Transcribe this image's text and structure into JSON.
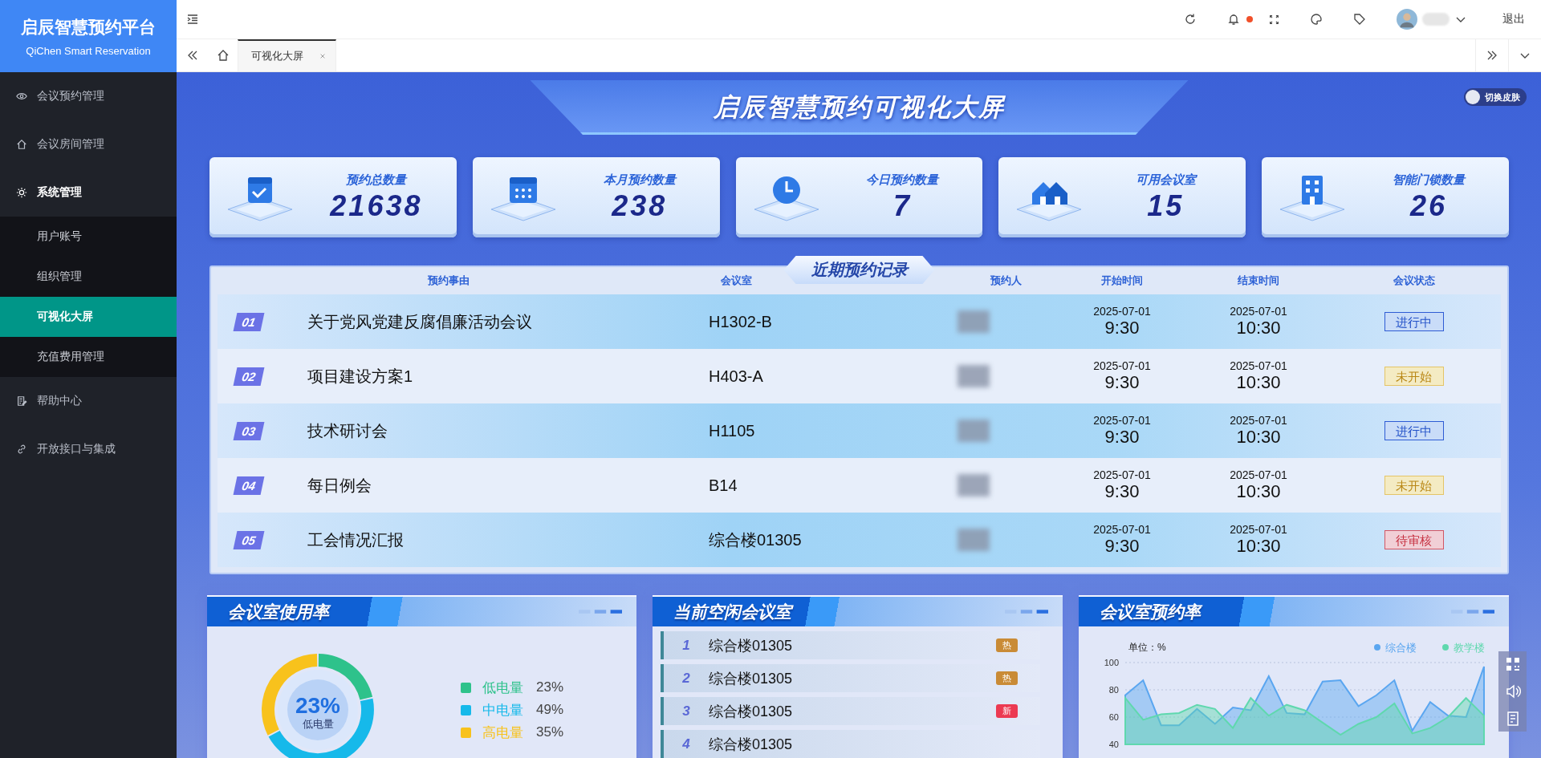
{
  "sidebar": {
    "brand_title": "启辰智慧预约平台",
    "brand_subtitle": "QiChen Smart Reservation",
    "items": [
      {
        "label": "会议预约管理",
        "selected": false,
        "expanded": false
      },
      {
        "label": "会议房间管理",
        "selected": false,
        "expanded": false
      },
      {
        "label": "系统管理",
        "selected": false,
        "expanded": true,
        "children": [
          {
            "label": "用户账号",
            "selected": false
          },
          {
            "label": "组织管理",
            "selected": false
          },
          {
            "label": "可视化大屏",
            "selected": true
          },
          {
            "label": "充值费用管理",
            "selected": false
          }
        ]
      },
      {
        "label": "帮助中心",
        "selected": false,
        "expanded": false
      },
      {
        "label": "开放接口与集成",
        "selected": false,
        "expanded": false
      }
    ]
  },
  "topbar": {
    "logout": "退出",
    "notification_unread": true
  },
  "tabs": [
    {
      "label": "可视化大屏",
      "selected": true
    }
  ],
  "dashboard": {
    "title": "启辰智慧预约可视化大屏",
    "skin_label": "切换皮肤",
    "stats": [
      {
        "label": "预约总数量",
        "value": "21638"
      },
      {
        "label": "本月预约数量",
        "value": "238"
      },
      {
        "label": "今日预约数量",
        "value": "7"
      },
      {
        "label": "可用会议室",
        "value": "15"
      },
      {
        "label": "智能门锁数量",
        "value": "26"
      }
    ],
    "recent": {
      "title": "近期预约记录",
      "columns": [
        "预约事由",
        "会议室",
        "预约人",
        "开始时间",
        "结束时间",
        "会议状态"
      ],
      "rows": [
        {
          "index": "01",
          "subject": "关于党风党建反腐倡廉活动会议",
          "room": "H1302-B",
          "start_date": "2025-07-01",
          "start_time": "9:30",
          "end_date": "2025-07-01",
          "end_time": "10:30",
          "status": {
            "label": "进行中",
            "kind": "active"
          }
        },
        {
          "index": "02",
          "subject": "项目建设方案1",
          "room": "H403-A",
          "start_date": "2025-07-01",
          "start_time": "9:30",
          "end_date": "2025-07-01",
          "end_time": "10:30",
          "status": {
            "label": "未开始",
            "kind": "pending"
          }
        },
        {
          "index": "03",
          "subject": "技术研讨会",
          "room": "H1105",
          "start_date": "2025-07-01",
          "start_time": "9:30",
          "end_date": "2025-07-01",
          "end_time": "10:30",
          "status": {
            "label": "进行中",
            "kind": "active"
          }
        },
        {
          "index": "04",
          "subject": "每日例会",
          "room": "B14",
          "start_date": "2025-07-01",
          "start_time": "9:30",
          "end_date": "2025-07-01",
          "end_time": "10:30",
          "status": {
            "label": "未开始",
            "kind": "pending"
          }
        },
        {
          "index": "05",
          "subject": "工会情况汇报",
          "room": "综合楼01305",
          "start_date": "2025-07-01",
          "start_time": "9:30",
          "end_date": "2025-07-01",
          "end_time": "10:30",
          "status": {
            "label": "待审核",
            "kind": "review"
          }
        }
      ]
    },
    "usage": {
      "title": "会议室使用率",
      "center_value": "23%",
      "center_label": "低电量",
      "chart_data": {
        "type": "donut",
        "categories": [
          "低电量",
          "中电量",
          "高电量"
        ],
        "values": [
          23,
          49,
          35
        ],
        "value_labels": [
          "23%",
          "49%",
          "35%"
        ]
      },
      "legend": [
        {
          "color": "#2ec28b"
        },
        {
          "color": "#16b9ea"
        },
        {
          "color": "#f8c21c"
        }
      ]
    },
    "idle_rooms": {
      "title": "当前空闲会议室",
      "items": [
        {
          "rank": "1",
          "name": "综合楼01305",
          "tag": {
            "label": "热",
            "kind": "hot"
          }
        },
        {
          "rank": "2",
          "name": "综合楼01305",
          "tag": {
            "label": "热",
            "kind": "hot"
          }
        },
        {
          "rank": "3",
          "name": "综合楼01305",
          "tag": {
            "label": "新",
            "kind": "new"
          }
        },
        {
          "rank": "4",
          "name": "综合楼01305"
        }
      ]
    },
    "booking_rate": {
      "title": "会议室预约率",
      "chart_data": {
        "type": "area",
        "ylabel": "单位：%",
        "ylim": [
          40,
          100
        ],
        "yticks": [
          40,
          60,
          80,
          100
        ],
        "grid": true,
        "legend": "top-right",
        "series": [
          {
            "name": "综合楼",
            "color": "#5aa6f0",
            "values": [
              76,
              87,
              54,
              54,
              66,
              55,
              67,
              65,
              90,
              63,
              62,
              86,
              87,
              68,
              76,
              87,
              50,
              71,
              61,
              60,
              97
            ]
          },
          {
            "name": "教学楼",
            "color": "#5fd8ae",
            "values": [
              74,
              58,
              62,
              63,
              69,
              66,
              52,
              74,
              61,
              69,
              65,
              56,
              47,
              55,
              60,
              70,
              48,
              52,
              60,
              74,
              61
            ]
          }
        ]
      }
    }
  }
}
